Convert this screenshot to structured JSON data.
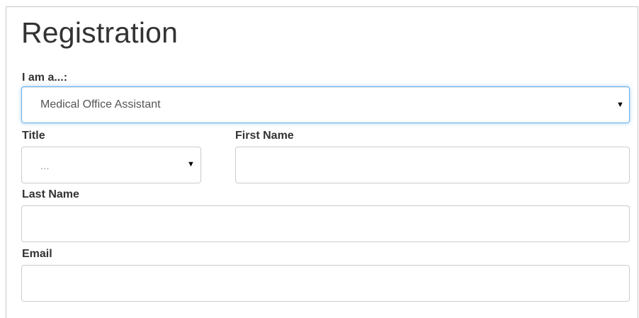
{
  "form": {
    "title": "Registration",
    "role": {
      "label": "I am a...:",
      "selected": "Medical Office Assistant"
    },
    "title_field": {
      "label": "Title",
      "placeholder": "..."
    },
    "first_name": {
      "label": "First Name",
      "value": ""
    },
    "last_name": {
      "label": "Last Name",
      "value": ""
    },
    "email": {
      "label": "Email",
      "value": ""
    }
  },
  "icons": {
    "dropdown_caret": "▼"
  },
  "colors": {
    "focus_border": "#66afe9",
    "input_border": "#cccccc",
    "text": "#333333"
  }
}
